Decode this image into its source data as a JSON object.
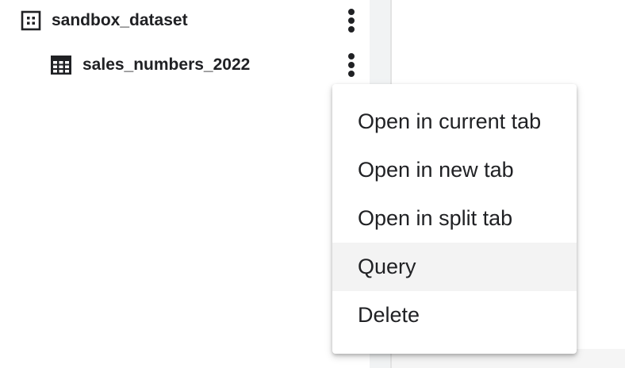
{
  "explorer": {
    "dataset": {
      "name": "sandbox_dataset",
      "icon": "dataset-icon",
      "more_icon": "more-vert-icon"
    },
    "table": {
      "name": "sales_numbers_2022",
      "icon": "table-icon",
      "more_icon": "more-vert-icon"
    }
  },
  "context_menu": {
    "items": [
      {
        "label": "Open in current tab"
      },
      {
        "label": "Open in new tab"
      },
      {
        "label": "Open in split tab"
      },
      {
        "label": "Query",
        "highlighted": true
      },
      {
        "label": "Delete"
      }
    ]
  },
  "colors": {
    "text": "#202124",
    "menu_hover": "#f3f3f3",
    "divider": "#f1f3f4"
  }
}
